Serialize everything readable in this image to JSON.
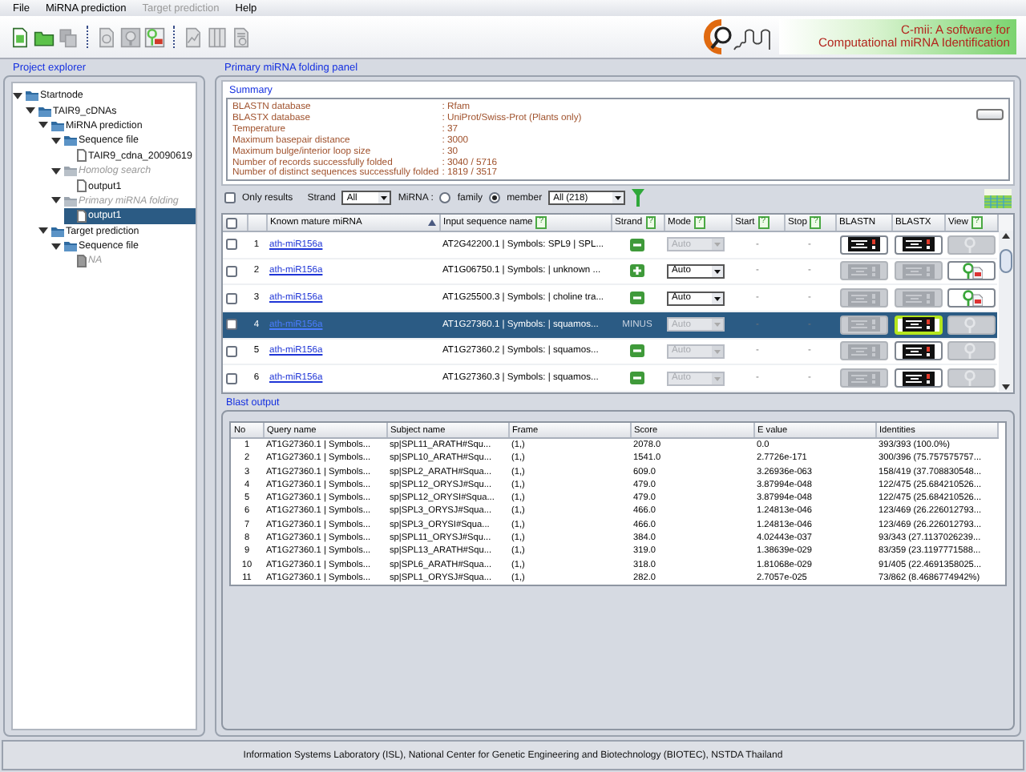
{
  "menu": [
    {
      "label": "File",
      "disabled": false
    },
    {
      "label": "MiRNA prediction",
      "disabled": false
    },
    {
      "label": "Target prediction",
      "disabled": true
    },
    {
      "label": "Help",
      "disabled": false
    }
  ],
  "toolbar": [
    {
      "buttons": [
        {
          "kind": "new",
          "disabled": false
        },
        {
          "kind": "open",
          "disabled": false
        },
        {
          "kind": "copy",
          "disabled": true
        }
      ]
    },
    {
      "buttons": [
        {
          "kind": "page-search",
          "disabled": true
        },
        {
          "kind": "find",
          "disabled": true
        },
        {
          "kind": "pri",
          "disabled": false
        }
      ]
    },
    {
      "buttons": [
        {
          "kind": "chart",
          "disabled": true
        },
        {
          "kind": "columns",
          "disabled": true
        },
        {
          "kind": "report",
          "disabled": true
        }
      ]
    }
  ],
  "logo": {
    "title": "C-mii: A software for",
    "subtitle": "Computational miRNA Identification"
  },
  "explorer": {
    "title": "Project explorer",
    "tree": [
      {
        "label": "Startnode",
        "kind": "folder",
        "expanded": true,
        "selected": false,
        "disabled": false,
        "children": [
          {
            "label": "TAIR9_cDNAs",
            "kind": "folder",
            "expanded": true,
            "selected": false,
            "disabled": false,
            "children": [
              {
                "label": "MiRNA prediction",
                "kind": "folder",
                "expanded": true,
                "selected": false,
                "disabled": false,
                "children": [
                  {
                    "label": "Sequence file",
                    "kind": "folder",
                    "expanded": true,
                    "selected": false,
                    "disabled": false,
                    "children": [
                      {
                        "label": "TAIR9_cdna_20090619",
                        "kind": "file",
                        "selected": false,
                        "disabled": false
                      }
                    ]
                  },
                  {
                    "label": "Homolog search",
                    "kind": "folder",
                    "expanded": true,
                    "selected": false,
                    "disabled": true,
                    "children": [
                      {
                        "label": "output1",
                        "kind": "file",
                        "selected": false,
                        "disabled": false
                      }
                    ]
                  },
                  {
                    "label": "Primary miRNA folding",
                    "kind": "folder",
                    "expanded": true,
                    "selected": false,
                    "disabled": true,
                    "children": [
                      {
                        "label": "output1",
                        "kind": "file",
                        "selected": true,
                        "disabled": false
                      }
                    ]
                  }
                ]
              },
              {
                "label": "Target prediction",
                "kind": "folder",
                "expanded": true,
                "selected": false,
                "disabled": false,
                "children": [
                  {
                    "label": "Sequence file",
                    "kind": "folder",
                    "expanded": true,
                    "selected": false,
                    "disabled": false,
                    "children": [
                      {
                        "label": "NA",
                        "kind": "file",
                        "selected": false,
                        "disabled": true
                      }
                    ]
                  }
                ]
              }
            ]
          }
        ]
      }
    ]
  },
  "panel": {
    "title": "Primary miRNA folding panel"
  },
  "summary": {
    "title": "Summary",
    "rows": [
      {
        "label": "BLASTN database",
        "value": ": Rfam"
      },
      {
        "label": "BLASTX database",
        "value": ": UniProt/Swiss-Prot (Plants only)"
      },
      {
        "label": "Temperature",
        "value": ": 37"
      },
      {
        "label": "Maximum basepair distance",
        "value": ": 3000"
      },
      {
        "label": "Maximum bulge/interior loop size",
        "value": ": 30"
      },
      {
        "label": "Number of records successfully folded",
        "value": ": 3040 / 5716"
      },
      {
        "label": "Number of distinct sequences successfully folded",
        "value": ": 1819 / 3517"
      }
    ]
  },
  "filters": {
    "only_results": {
      "label": "Only results",
      "checked": false
    },
    "strand": {
      "label": "Strand",
      "value": "All"
    },
    "mirna": {
      "label": "MiRNA :",
      "options": [
        {
          "label": "family",
          "selected": false
        },
        {
          "label": "member",
          "selected": true
        }
      ],
      "value": "All (218)"
    }
  },
  "results": {
    "select_all": {
      "checked": false
    },
    "columns": [
      {
        "label": "Known mature miRNA",
        "sorted": true
      },
      {
        "label": "Input sequence name",
        "sorted": false,
        "help": "?"
      },
      {
        "label": "Strand",
        "sorted": false,
        "help": "?"
      },
      {
        "label": "Mode",
        "sorted": false,
        "help": "?"
      },
      {
        "label": "Start",
        "sorted": false,
        "help": "?"
      },
      {
        "label": "Stop",
        "sorted": false,
        "help": "?"
      },
      {
        "label": "BLASTN",
        "sorted": false
      },
      {
        "label": "BLASTX",
        "sorted": false
      },
      {
        "label": "View",
        "sorted": false,
        "help": "?"
      }
    ],
    "rows": [
      {
        "number": "1",
        "checked": false,
        "selected": false,
        "mirna": "ath-miR156a",
        "sequence": "AT2G42200.1 | Symbols: SPL9 | SPL...",
        "strand": {
          "kind": "minus"
        },
        "mode": {
          "value": "Auto",
          "disabled": true
        },
        "start": "-",
        "stop": "-",
        "blastn": {
          "enabled": true
        },
        "blastx": {
          "enabled": true,
          "focused": false
        },
        "view": {
          "enabled": false
        }
      },
      {
        "number": "2",
        "checked": false,
        "selected": false,
        "mirna": "ath-miR156a",
        "sequence": "AT1G06750.1 | Symbols:  | unknown ...",
        "strand": {
          "kind": "plus"
        },
        "mode": {
          "value": "Auto",
          "disabled": false
        },
        "start": "-",
        "stop": "-",
        "blastn": {
          "enabled": false
        },
        "blastx": {
          "enabled": false,
          "focused": false
        },
        "view": {
          "enabled": true
        }
      },
      {
        "number": "3",
        "checked": false,
        "selected": false,
        "mirna": "ath-miR156a",
        "sequence": "AT1G25500.3 | Symbols:  | choline tra...",
        "strand": {
          "kind": "minus"
        },
        "mode": {
          "value": "Auto",
          "disabled": false
        },
        "start": "-",
        "stop": "-",
        "blastn": {
          "enabled": false
        },
        "blastx": {
          "enabled": false,
          "focused": false
        },
        "view": {
          "enabled": true
        }
      },
      {
        "number": "4",
        "checked": false,
        "selected": true,
        "mirna": "ath-miR156a",
        "sequence": "AT1G27360.1 | Symbols:  | squamos...",
        "strand": {
          "kind": "text",
          "label": "MINUS"
        },
        "mode": {
          "value": "Auto",
          "disabled": true
        },
        "start": "-",
        "stop": "-",
        "blastn": {
          "enabled": false
        },
        "blastx": {
          "enabled": true,
          "focused": true
        },
        "view": {
          "enabled": false
        }
      },
      {
        "number": "5",
        "checked": false,
        "selected": false,
        "mirna": "ath-miR156a",
        "sequence": "AT1G27360.2 | Symbols:  | squamos...",
        "strand": {
          "kind": "minus"
        },
        "mode": {
          "value": "Auto",
          "disabled": true
        },
        "start": "-",
        "stop": "-",
        "blastn": {
          "enabled": false
        },
        "blastx": {
          "enabled": true,
          "focused": false
        },
        "view": {
          "enabled": false
        }
      },
      {
        "number": "6",
        "checked": false,
        "selected": false,
        "mirna": "ath-miR156a",
        "sequence": "AT1G27360.3 | Symbols:  | squamos...",
        "strand": {
          "kind": "minus"
        },
        "mode": {
          "value": "Auto",
          "disabled": true
        },
        "start": "-",
        "stop": "-",
        "blastn": {
          "enabled": false
        },
        "blastx": {
          "enabled": true,
          "focused": false
        },
        "view": {
          "enabled": false
        }
      }
    ]
  },
  "blast": {
    "title": "Blast output",
    "columns": [
      "No",
      "Query name",
      "Subject name",
      "Frame",
      "Score",
      "E value",
      "Identities"
    ],
    "rows": [
      [
        "1",
        "AT1G27360.1 | Symbols...",
        "sp|SPL11_ARATH#Squ...",
        "(1,)",
        "2078.0",
        "0.0",
        "393/393 (100.0%)"
      ],
      [
        "2",
        "AT1G27360.1 | Symbols...",
        "sp|SPL10_ARATH#Squ...",
        "(1,)",
        "1541.0",
        "2.7726e-171",
        "300/396 (75.757575757..."
      ],
      [
        "3",
        "AT1G27360.1 | Symbols...",
        "sp|SPL2_ARATH#Squa...",
        "(1,)",
        "609.0",
        "3.26936e-063",
        "158/419 (37.708830548..."
      ],
      [
        "4",
        "AT1G27360.1 | Symbols...",
        "sp|SPL12_ORYSJ#Squ...",
        "(1,)",
        "479.0",
        "3.87994e-048",
        "122/475 (25.684210526..."
      ],
      [
        "5",
        "AT1G27360.1 | Symbols...",
        "sp|SPL12_ORYSI#Squa...",
        "(1,)",
        "479.0",
        "3.87994e-048",
        "122/475 (25.684210526..."
      ],
      [
        "6",
        "AT1G27360.1 | Symbols...",
        "sp|SPL3_ORYSJ#Squa...",
        "(1,)",
        "466.0",
        "1.24813e-046",
        "123/469 (26.226012793..."
      ],
      [
        "7",
        "AT1G27360.1 | Symbols...",
        "sp|SPL3_ORYSI#Squa...",
        "(1,)",
        "466.0",
        "1.24813e-046",
        "123/469 (26.226012793..."
      ],
      [
        "8",
        "AT1G27360.1 | Symbols...",
        "sp|SPL11_ORYSJ#Squ...",
        "(1,)",
        "384.0",
        "4.02443e-037",
        "93/343 (27.1137026239..."
      ],
      [
        "9",
        "AT1G27360.1 | Symbols...",
        "sp|SPL13_ARATH#Squ...",
        "(1,)",
        "319.0",
        "1.38639e-029",
        "83/359 (23.1197771588..."
      ],
      [
        "10",
        "AT1G27360.1 | Symbols...",
        "sp|SPL6_ARATH#Squa...",
        "(1,)",
        "318.0",
        "1.81068e-029",
        "91/405 (22.4691358025..."
      ],
      [
        "11",
        "AT1G27360.1 | Symbols...",
        "sp|SPL1_ORYSJ#Squa...",
        "(1,)",
        "282.0",
        "2.7057e-025",
        "73/862 (8.4686774942%)"
      ]
    ]
  },
  "status": "Information Systems Laboratory (ISL), National Center for Genetic Engineering and Biotechnology (BIOTEC), NSTDA Thailand"
}
